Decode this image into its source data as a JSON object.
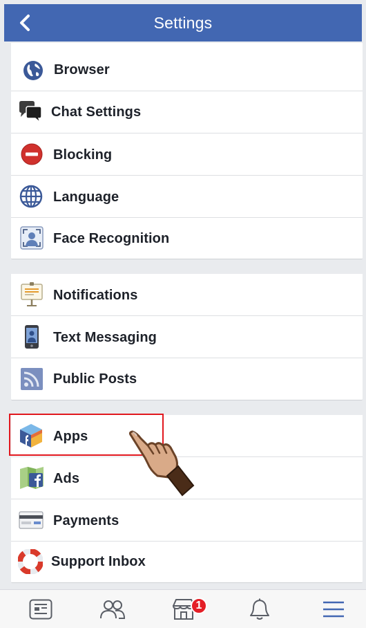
{
  "header": {
    "title": "Settings"
  },
  "group1": [
    {
      "label": "Browser",
      "icon": "globe-icon"
    },
    {
      "label": "Chat Settings",
      "icon": "chat-bubbles-icon"
    },
    {
      "label": "Blocking",
      "icon": "block-icon"
    },
    {
      "label": "Language",
      "icon": "language-globe-icon"
    },
    {
      "label": "Face Recognition",
      "icon": "face-recognition-icon"
    }
  ],
  "group2": [
    {
      "label": "Notifications",
      "icon": "notification-board-icon"
    },
    {
      "label": "Text Messaging",
      "icon": "phone-icon"
    },
    {
      "label": "Public Posts",
      "icon": "rss-feed-icon"
    }
  ],
  "group3": [
    {
      "label": "Apps",
      "icon": "app-cube-icon"
    },
    {
      "label": "Ads",
      "icon": "ads-map-icon"
    },
    {
      "label": "Payments",
      "icon": "credit-card-icon"
    },
    {
      "label": "Support Inbox",
      "icon": "lifebuoy-icon"
    }
  ],
  "tabbar": {
    "tabs": [
      "news-feed-icon",
      "friends-icon",
      "marketplace-icon",
      "bell-icon",
      "menu-icon"
    ],
    "marketplace_badge": "1"
  },
  "colors": {
    "header": "#4267b2",
    "highlight": "#e1171e",
    "badge": "#e41e26",
    "active_tab": "#4267b2"
  }
}
